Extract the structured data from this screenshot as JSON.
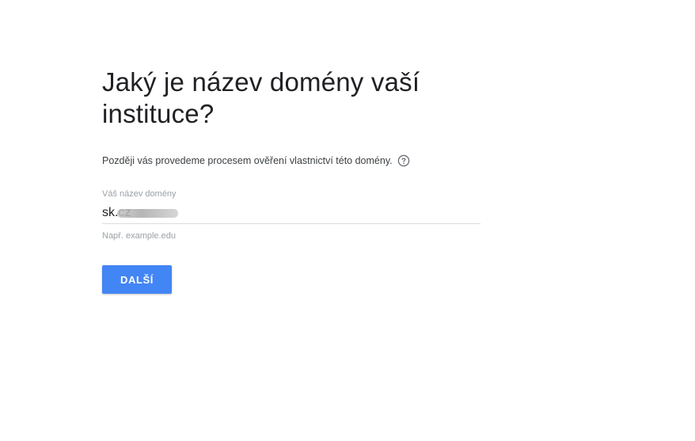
{
  "page": {
    "heading": "Jaký je název domény vaší instituce?",
    "subtext": "Později vás provedeme procesem ověření vlastnictví této domény.",
    "help_icon": "help-circle-icon"
  },
  "domain_field": {
    "label": "Váš název domény",
    "value": "sk.cz",
    "hint": "Např. example.edu"
  },
  "actions": {
    "next_label": "DALŠÍ"
  },
  "colors": {
    "primary_button": "#4285f4",
    "heading_text": "#202124",
    "muted_text": "#9aa0a6"
  }
}
